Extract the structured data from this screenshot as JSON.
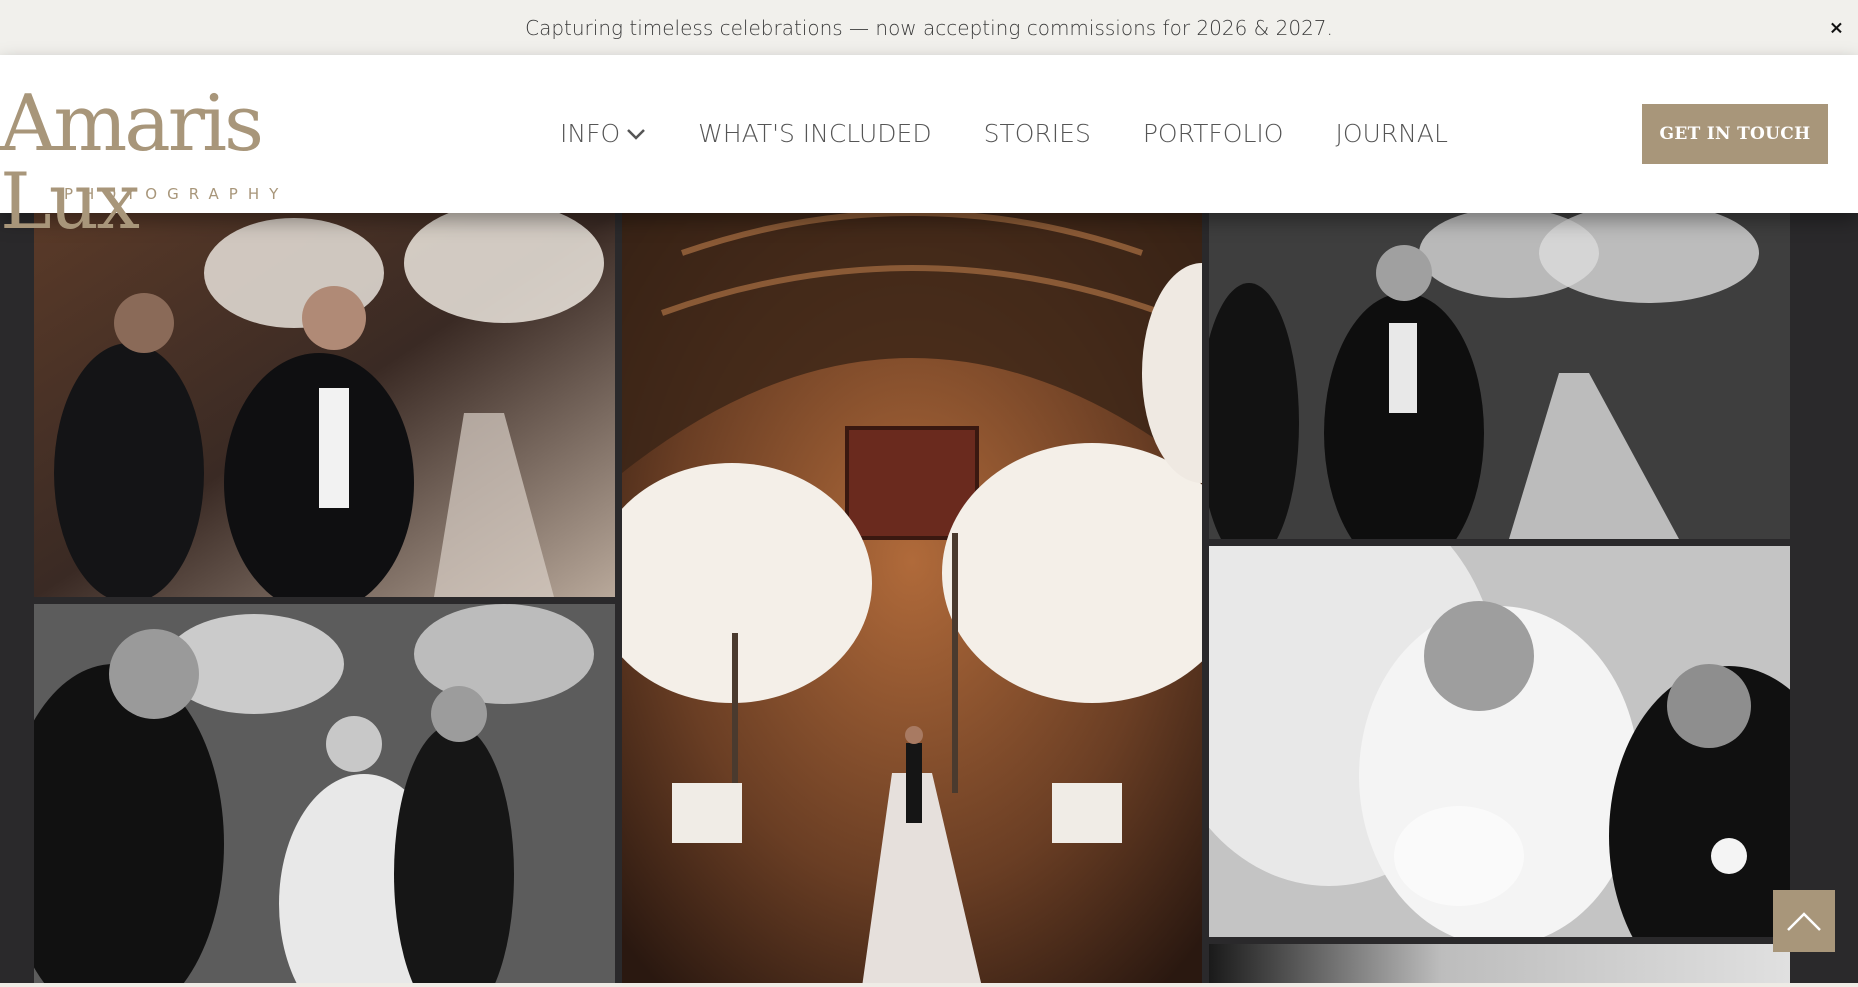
{
  "announcement": {
    "text": "Capturing timeless celebrations — now accepting commissions for 2026 & 2027.",
    "close_label": "×"
  },
  "logo": {
    "main": "Amaris Lux",
    "sub": "PHOTOGRAPHY"
  },
  "nav": {
    "items": [
      {
        "label": "INFO",
        "has_dropdown": true
      },
      {
        "label": "WHAT'S INCLUDED"
      },
      {
        "label": "STORIES"
      },
      {
        "label": "PORTFOLIO"
      },
      {
        "label": "JOURNAL"
      }
    ]
  },
  "cta": {
    "label": "GET IN TOUCH"
  },
  "colors": {
    "brand": "#a8967a",
    "announcement_bg": "#f1f0ec",
    "page_bg": "#2a292b"
  },
  "icons": {
    "close": "close-icon",
    "dropdown": "chevron-down-icon",
    "back_to_top": "chevron-up-icon"
  }
}
